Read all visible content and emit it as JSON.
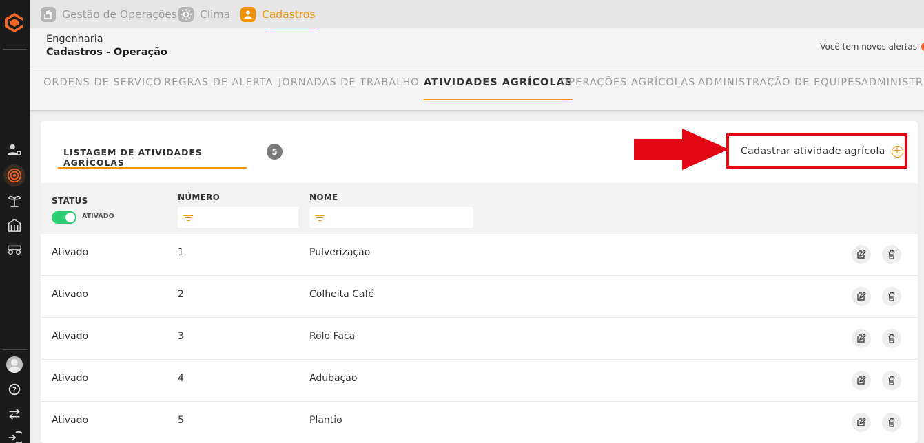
{
  "modules": [
    {
      "label": "Gestão de Operações",
      "icon": "hand-icon",
      "active": false
    },
    {
      "label": "Clima",
      "icon": "sun-icon",
      "active": false
    },
    {
      "label": "Cadastros",
      "icon": "user-icon",
      "active": true
    }
  ],
  "header": {
    "breadcrumb_parent": "Engenharia",
    "breadcrumb_current": "Cadastros - Operação",
    "alerts_text": "Você tem novos alertas"
  },
  "tabs": [
    {
      "label": "ORDENS DE SERVIÇO"
    },
    {
      "label": "REGRAS DE ALERTA"
    },
    {
      "label": "JORNADAS DE TRABALHO"
    },
    {
      "label": "ATIVIDADES AGRÍCOLAS",
      "active": true
    },
    {
      "label": "OPERAÇÕES AGRÍCOLAS"
    },
    {
      "label": "ADMINISTRAÇÃO DE EQUIPES"
    },
    {
      "label": "ADMINISTR"
    }
  ],
  "list": {
    "title": "LISTAGEM DE ATIVIDADES AGRÍCOLAS",
    "count": "5",
    "add_button_label": "Cadastrar atividade agrícola"
  },
  "columns": {
    "status": "STATUS",
    "status_toggle_label": "ATIVADO",
    "numero": "NÚMERO",
    "nome": "NOME"
  },
  "filters": {
    "numero_value": "",
    "nome_value": ""
  },
  "rows": [
    {
      "status": "Ativado",
      "numero": "1",
      "nome": "Pulverização"
    },
    {
      "status": "Ativado",
      "numero": "2",
      "nome": "Colheita Café"
    },
    {
      "status": "Ativado",
      "numero": "3",
      "nome": "Rolo Faca"
    },
    {
      "status": "Ativado",
      "numero": "4",
      "nome": "Adubação"
    },
    {
      "status": "Ativado",
      "numero": "5",
      "nome": "Plantio"
    }
  ],
  "colors": {
    "accent": "#f39200",
    "highlight": "#e30613",
    "toggle_on": "#2ecc71",
    "sidebar": "#1b1b1b"
  }
}
